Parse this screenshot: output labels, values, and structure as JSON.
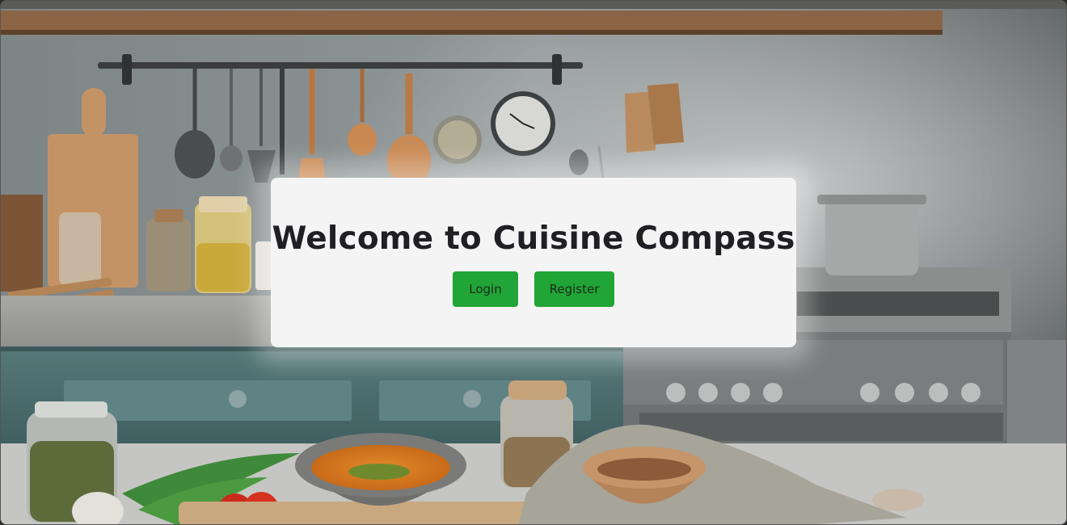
{
  "page": {
    "heading": "Welcome to Cuisine Compass",
    "login_label": "Login",
    "register_label": "Register"
  },
  "colors": {
    "button": "#21a536",
    "card": "#f4f4f4",
    "heading_text": "#1f1f24"
  },
  "background_scene": "kitchen-background-image"
}
